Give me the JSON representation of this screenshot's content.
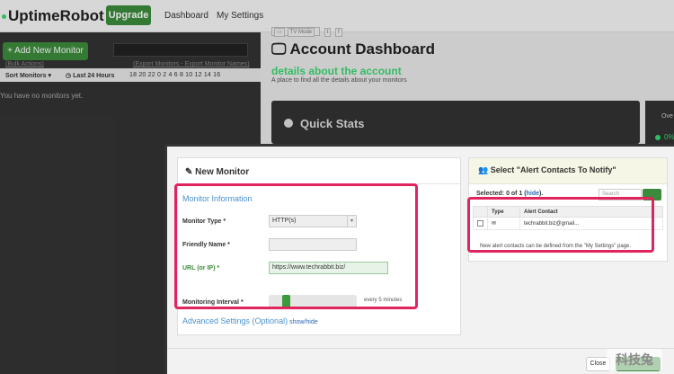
{
  "header": {
    "logo": "UptimeRobot",
    "upgrade": "Upgrade",
    "nav": [
      "Dashboard",
      "My Settings"
    ]
  },
  "left_panel": {
    "add_monitor": "+ Add New Monitor",
    "bulk_actions": "(Bulk Actions)",
    "export_link": "(Export Monitors - Export Monitor Names)",
    "sort": "Sort Monitors ▾",
    "timeframe": "Last 24 Hours",
    "hours": "18  20  22  0  2  4  6  8  10  12  14  16",
    "empty": "You have no monitors yet."
  },
  "dashboard": {
    "tv_mode": "TV Mode",
    "title": "Account Dashboard",
    "subtitle": "details about the account",
    "description": "A place to find all the details about your monitors",
    "quick_stats": "Quick Stats",
    "overall_label": "Ove",
    "overall_value": "0%"
  },
  "modal": {
    "title": "New Monitor",
    "section": "Monitor Information",
    "fields": {
      "type_label": "Monitor Type *",
      "type_value": "HTTP(s)",
      "name_label": "Friendly Name *",
      "name_value": "",
      "url_label": "URL (or IP) *",
      "url_value": "https://www.techrabbit.biz/",
      "interval_label": "Monitoring Interval *",
      "interval_value": 5,
      "interval_text": "every 5 minutes"
    },
    "advanced": "Advanced Settings (Optional)",
    "advanced_toggle": "show/hide",
    "alerts": {
      "title": "Select \"Alert Contacts To Notify\"",
      "selected_prefix": "Selected: 0 of 1 (",
      "hide": "hide",
      "selected_suffix": ").",
      "search_placeholder": "Search",
      "columns": [
        "Type",
        "Alert Contact"
      ],
      "rows": [
        {
          "type_icon": "email-icon",
          "contact": "techrabbit.biz@gmail..."
        }
      ],
      "note": "New alert contacts can be defined from the \"My Settings\" page."
    },
    "close": "Close"
  },
  "watermark": "科技兔",
  "colors": {
    "brand_green": "#3c8a3c",
    "status_green": "#3bd671",
    "link_blue": "#4a90c8",
    "highlight": "#e0245e",
    "dark_panel": "#333333"
  }
}
